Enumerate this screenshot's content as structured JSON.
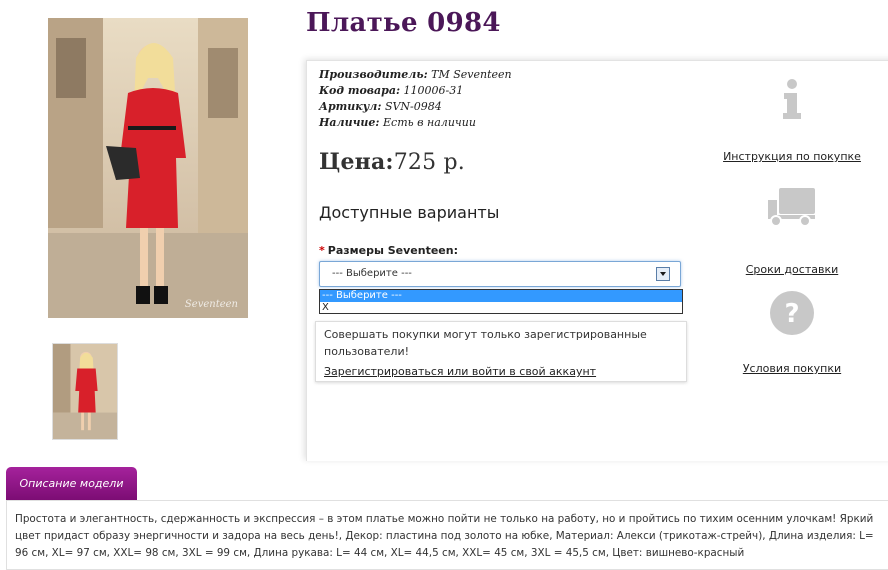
{
  "product": {
    "title": "Платье 0984"
  },
  "specs": [
    {
      "label": "Производитель:",
      "value": "ТМ Seventeen"
    },
    {
      "label": "Код товара:",
      "value": "110006-31"
    },
    {
      "label": "Артикул:",
      "value": "SVN-0984"
    },
    {
      "label": "Наличие:",
      "value": "Есть в наличии"
    }
  ],
  "price": {
    "label": "Цена:",
    "value": "725 р."
  },
  "variants": {
    "heading": "Доступные варианты",
    "required_mark": "*",
    "size_label": "Размеры Seventeen:",
    "select_value": "--- Выберите ---",
    "options": [
      "--- Выберите ---",
      "X"
    ]
  },
  "notice": {
    "text": "Совершать покупки могут только зарегистрированные пользователи!",
    "link": "Зарегистрироваться или войти в свой аккаунт"
  },
  "info_links": [
    {
      "icon": "info-icon",
      "label": "Инструкция по покупке"
    },
    {
      "icon": "truck-icon",
      "label": "Сроки доставки"
    },
    {
      "icon": "question-icon",
      "label": "Условия покупки"
    }
  ],
  "photo": {
    "watermark": "Seventeen"
  },
  "description": {
    "tab_label": "Описание модели",
    "text": "Простота и элегантность, сдержанность и экспрессия – в этом платье можно пойти не только на работу, но и пройтись по тихим осенним улочкам! Яркий цвет придаст образу энергичности и задора на весь день!, Декор: пластина под золото на юбке, Материал: Алекси (трикотаж-стрейч), Длина изделия: L= 96 см, XL= 97 см, XXL= 98 см, 3XL = 99 см, Длина рукава: L= 44 см, XL= 44,5 см, XXL= 45 см, 3XL = 45,5 см, Цвет: вишнево-красный"
  },
  "colors": {
    "title": "#4b1758",
    "tab": "#8e1686",
    "dress": "#d8202a",
    "selected_option": "#3399ff"
  }
}
